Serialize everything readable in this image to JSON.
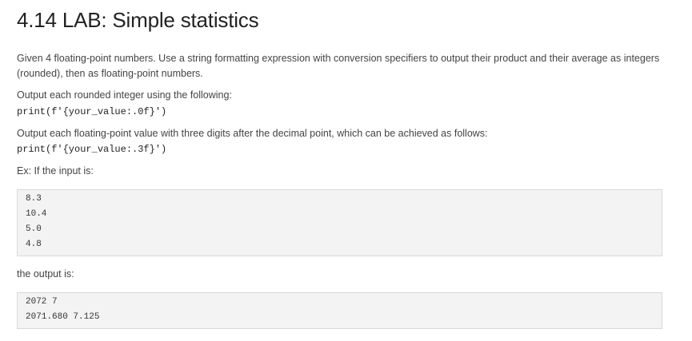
{
  "title": "4.14 LAB: Simple statistics",
  "intro": "Given 4 floating-point numbers. Use a string formatting expression with conversion specifiers to output their product and their average as integers (rounded), then as floating-point numbers.",
  "integer_instruction": "Output each rounded integer using the following:",
  "integer_code": "print(f'{your_value:.0f}')",
  "float_instruction": "Output each floating-point value with three digits after the decimal point, which can be achieved as follows:",
  "float_code": "print(f'{your_value:.3f}')",
  "example_intro": "Ex: If the input is:",
  "input_lines": [
    "8.3",
    "10.4",
    "5.0",
    "4.8"
  ],
  "output_intro": "the output is:",
  "output_lines": [
    "2072 7",
    "2071.680 7.125"
  ]
}
